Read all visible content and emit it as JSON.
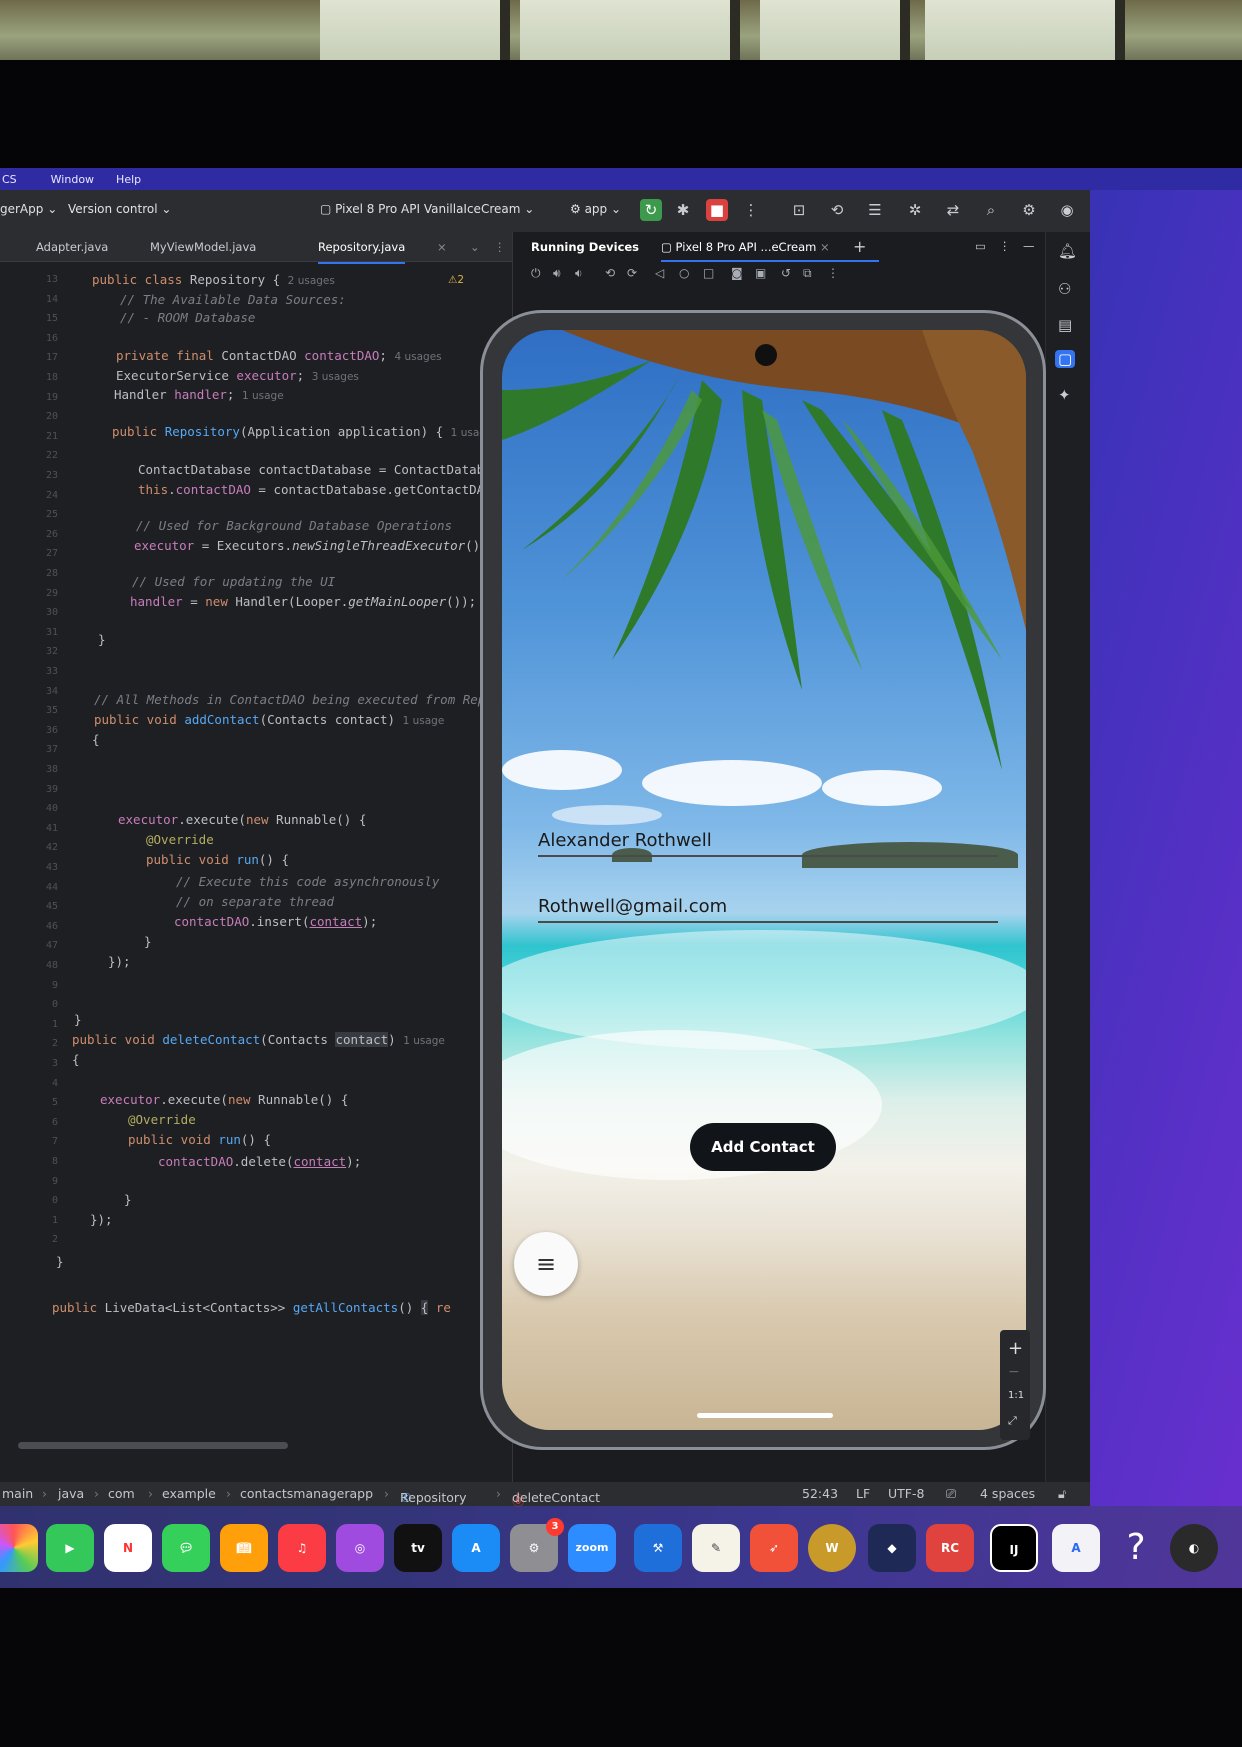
{
  "menubar": {
    "items": [
      "CS",
      "Window",
      "Help"
    ]
  },
  "toolbar": {
    "project": "gerApp",
    "vcs": "Version control",
    "device": "Pixel 8 Pro API VanillaIceCream",
    "run_config": "app"
  },
  "editor": {
    "tabs": [
      "Adapter.java",
      "MyViewModel.java",
      "Repository.java"
    ],
    "active_tab": "Repository.java",
    "warnings": "2",
    "line_numbers": [
      "13",
      "14",
      "15",
      "16",
      "17",
      "18",
      "19",
      "20",
      "21",
      "22",
      "23",
      "24",
      "25",
      "26",
      "27",
      "28",
      "29",
      "30",
      "31",
      "32",
      "33",
      "34",
      "35",
      "36",
      "37",
      "38",
      "39",
      "40",
      "41",
      "42",
      "43",
      "44",
      "45",
      "46",
      "47",
      "48",
      "9",
      "0",
      "1",
      "2",
      "3",
      "4",
      "5",
      "6",
      "7",
      "8",
      "9",
      "0",
      "1",
      "2"
    ],
    "hints": {
      "usages2": "2 usages",
      "usages4": "4 usages",
      "usages3": "3 usages",
      "usage1": "1 usage"
    }
  },
  "devices": {
    "panel_title": "Running Devices",
    "device_tab": "Pixel 8 Pro API ...eCream"
  },
  "app": {
    "name_value": "Alexander Rothwell",
    "email_value": "Rothwell@gmail.com",
    "add_button": "Add Contact"
  },
  "statusbar": {
    "breadcrumbs": [
      "main",
      "java",
      "com",
      "example",
      "contactsmanagerapp",
      "Repository",
      "deleteContact"
    ],
    "position": "52:43",
    "line_sep": "LF",
    "encoding": "UTF-8",
    "indent": "4 spaces"
  },
  "dock": {
    "apps": [
      "Photos",
      "FaceTime",
      "News",
      "Messages",
      "Books",
      "Music",
      "Podcasts",
      "TV",
      "App Store",
      "System Settings",
      "Zoom",
      "Xcode",
      "TextEdit",
      "Swift Playgrounds",
      "World of Warcraft",
      "Games",
      "RollerCoaster",
      "IntelliJ IDEA",
      "Instruments",
      "Help",
      "Logic"
    ],
    "tv_label": "tv",
    "zoom_label": "zoom",
    "ij_label": "IJ",
    "settings_badge": "3",
    "help_label": "?"
  },
  "colors": {
    "accent": "#3574f0",
    "keyword": "#cf8e6d",
    "function": "#56a8f5",
    "field": "#c77dbb",
    "comment": "#7a7e85"
  }
}
